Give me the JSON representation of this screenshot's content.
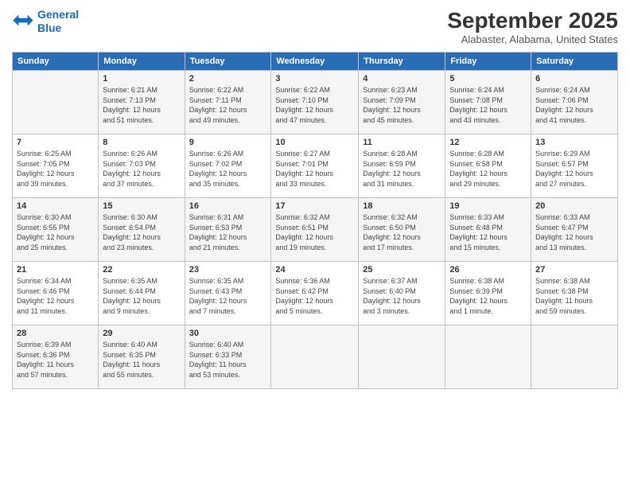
{
  "logo": {
    "line1": "General",
    "line2": "Blue"
  },
  "title": "September 2025",
  "location": "Alabaster, Alabama, United States",
  "days_header": [
    "Sunday",
    "Monday",
    "Tuesday",
    "Wednesday",
    "Thursday",
    "Friday",
    "Saturday"
  ],
  "weeks": [
    [
      {
        "day": "",
        "info": ""
      },
      {
        "day": "1",
        "info": "Sunrise: 6:21 AM\nSunset: 7:13 PM\nDaylight: 12 hours\nand 51 minutes."
      },
      {
        "day": "2",
        "info": "Sunrise: 6:22 AM\nSunset: 7:11 PM\nDaylight: 12 hours\nand 49 minutes."
      },
      {
        "day": "3",
        "info": "Sunrise: 6:22 AM\nSunset: 7:10 PM\nDaylight: 12 hours\nand 47 minutes."
      },
      {
        "day": "4",
        "info": "Sunrise: 6:23 AM\nSunset: 7:09 PM\nDaylight: 12 hours\nand 45 minutes."
      },
      {
        "day": "5",
        "info": "Sunrise: 6:24 AM\nSunset: 7:08 PM\nDaylight: 12 hours\nand 43 minutes."
      },
      {
        "day": "6",
        "info": "Sunrise: 6:24 AM\nSunset: 7:06 PM\nDaylight: 12 hours\nand 41 minutes."
      }
    ],
    [
      {
        "day": "7",
        "info": "Sunrise: 6:25 AM\nSunset: 7:05 PM\nDaylight: 12 hours\nand 39 minutes."
      },
      {
        "day": "8",
        "info": "Sunrise: 6:26 AM\nSunset: 7:03 PM\nDaylight: 12 hours\nand 37 minutes."
      },
      {
        "day": "9",
        "info": "Sunrise: 6:26 AM\nSunset: 7:02 PM\nDaylight: 12 hours\nand 35 minutes."
      },
      {
        "day": "10",
        "info": "Sunrise: 6:27 AM\nSunset: 7:01 PM\nDaylight: 12 hours\nand 33 minutes."
      },
      {
        "day": "11",
        "info": "Sunrise: 6:28 AM\nSunset: 6:59 PM\nDaylight: 12 hours\nand 31 minutes."
      },
      {
        "day": "12",
        "info": "Sunrise: 6:28 AM\nSunset: 6:58 PM\nDaylight: 12 hours\nand 29 minutes."
      },
      {
        "day": "13",
        "info": "Sunrise: 6:29 AM\nSunset: 6:57 PM\nDaylight: 12 hours\nand 27 minutes."
      }
    ],
    [
      {
        "day": "14",
        "info": "Sunrise: 6:30 AM\nSunset: 6:55 PM\nDaylight: 12 hours\nand 25 minutes."
      },
      {
        "day": "15",
        "info": "Sunrise: 6:30 AM\nSunset: 6:54 PM\nDaylight: 12 hours\nand 23 minutes."
      },
      {
        "day": "16",
        "info": "Sunrise: 6:31 AM\nSunset: 6:53 PM\nDaylight: 12 hours\nand 21 minutes."
      },
      {
        "day": "17",
        "info": "Sunrise: 6:32 AM\nSunset: 6:51 PM\nDaylight: 12 hours\nand 19 minutes."
      },
      {
        "day": "18",
        "info": "Sunrise: 6:32 AM\nSunset: 6:50 PM\nDaylight: 12 hours\nand 17 minutes."
      },
      {
        "day": "19",
        "info": "Sunrise: 6:33 AM\nSunset: 6:48 PM\nDaylight: 12 hours\nand 15 minutes."
      },
      {
        "day": "20",
        "info": "Sunrise: 6:33 AM\nSunset: 6:47 PM\nDaylight: 12 hours\nand 13 minutes."
      }
    ],
    [
      {
        "day": "21",
        "info": "Sunrise: 6:34 AM\nSunset: 6:46 PM\nDaylight: 12 hours\nand 11 minutes."
      },
      {
        "day": "22",
        "info": "Sunrise: 6:35 AM\nSunset: 6:44 PM\nDaylight: 12 hours\nand 9 minutes."
      },
      {
        "day": "23",
        "info": "Sunrise: 6:35 AM\nSunset: 6:43 PM\nDaylight: 12 hours\nand 7 minutes."
      },
      {
        "day": "24",
        "info": "Sunrise: 6:36 AM\nSunset: 6:42 PM\nDaylight: 12 hours\nand 5 minutes."
      },
      {
        "day": "25",
        "info": "Sunrise: 6:37 AM\nSunset: 6:40 PM\nDaylight: 12 hours\nand 3 minutes."
      },
      {
        "day": "26",
        "info": "Sunrise: 6:38 AM\nSunset: 6:39 PM\nDaylight: 12 hours\nand 1 minute."
      },
      {
        "day": "27",
        "info": "Sunrise: 6:38 AM\nSunset: 6:38 PM\nDaylight: 11 hours\nand 59 minutes."
      }
    ],
    [
      {
        "day": "28",
        "info": "Sunrise: 6:39 AM\nSunset: 6:36 PM\nDaylight: 11 hours\nand 57 minutes."
      },
      {
        "day": "29",
        "info": "Sunrise: 6:40 AM\nSunset: 6:35 PM\nDaylight: 11 hours\nand 55 minutes."
      },
      {
        "day": "30",
        "info": "Sunrise: 6:40 AM\nSunset: 6:33 PM\nDaylight: 11 hours\nand 53 minutes."
      },
      {
        "day": "",
        "info": ""
      },
      {
        "day": "",
        "info": ""
      },
      {
        "day": "",
        "info": ""
      },
      {
        "day": "",
        "info": ""
      }
    ]
  ]
}
